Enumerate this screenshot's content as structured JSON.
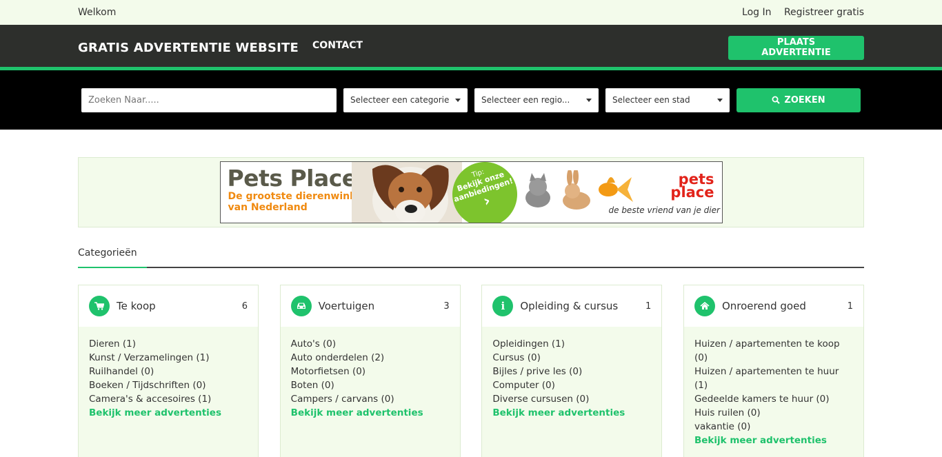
{
  "topbar": {
    "welcome": "Welkom",
    "login": "Log In",
    "register": "Registreer gratis"
  },
  "navbar": {
    "brand": "GRATIS ADVERTENTIE WEBSITE",
    "contact": "CONTACT",
    "place_ad": "PLAATS ADVERTENTIE"
  },
  "search": {
    "placeholder": "Zoeken Naar.....",
    "category": "Selecteer een categorie",
    "region": "Selecteer een regio...",
    "city": "Selecteer een stad",
    "button": "ZOEKEN"
  },
  "banner": {
    "title": "Pets Place",
    "subtitle_1": "De grootste dierenwinkel",
    "subtitle_2": "van Nederland",
    "tip": "Tip:",
    "tip_text_1": "Bekijk onze",
    "tip_text_2": "aanbiedingen!",
    "logo_1": "pets",
    "logo_2": "place",
    "slogan": "de beste vriend van je dier"
  },
  "categories_heading": "Categorieën",
  "cards": [
    {
      "icon": "cart-icon",
      "title": "Te koop",
      "count": "6",
      "items": [
        "Dieren (1)",
        "Kunst / Verzamelingen (1)",
        "Ruilhandel (0)",
        "Boeken / Tijdschriften (0)",
        "Camera's & accesoires (1)"
      ],
      "more": "Bekijk meer advertenties"
    },
    {
      "icon": "car-icon",
      "title": "Voertuigen",
      "count": "3",
      "items": [
        "Auto's (0)",
        "Auto onderdelen (2)",
        "Motorfietsen (0)",
        "Boten (0)",
        "Campers / carvans (0)"
      ],
      "more": "Bekijk meer advertenties"
    },
    {
      "icon": "info-icon",
      "title": "Opleiding & cursus",
      "count": "1",
      "items": [
        "Opleidingen (1)",
        "Cursus (0)",
        "Bijles / prive les (0)",
        "Computer (0)",
        "Diverse cursusen (0)"
      ],
      "more": "Bekijk meer advertenties"
    },
    {
      "icon": "home-icon",
      "title": "Onroerend goed",
      "count": "1",
      "items": [
        "Huizen / apartementen te koop (0)",
        "Huizen / apartementen te huur (1)",
        "Gedeelde kamers te huur (0)",
        "Huis ruilen (0)",
        "vakantie (0)"
      ],
      "more": "Bekijk meer advertenties"
    }
  ],
  "colors": {
    "accent": "#1fc26c",
    "nav": "#2d2f2c",
    "soft": "#f3fbeb"
  }
}
